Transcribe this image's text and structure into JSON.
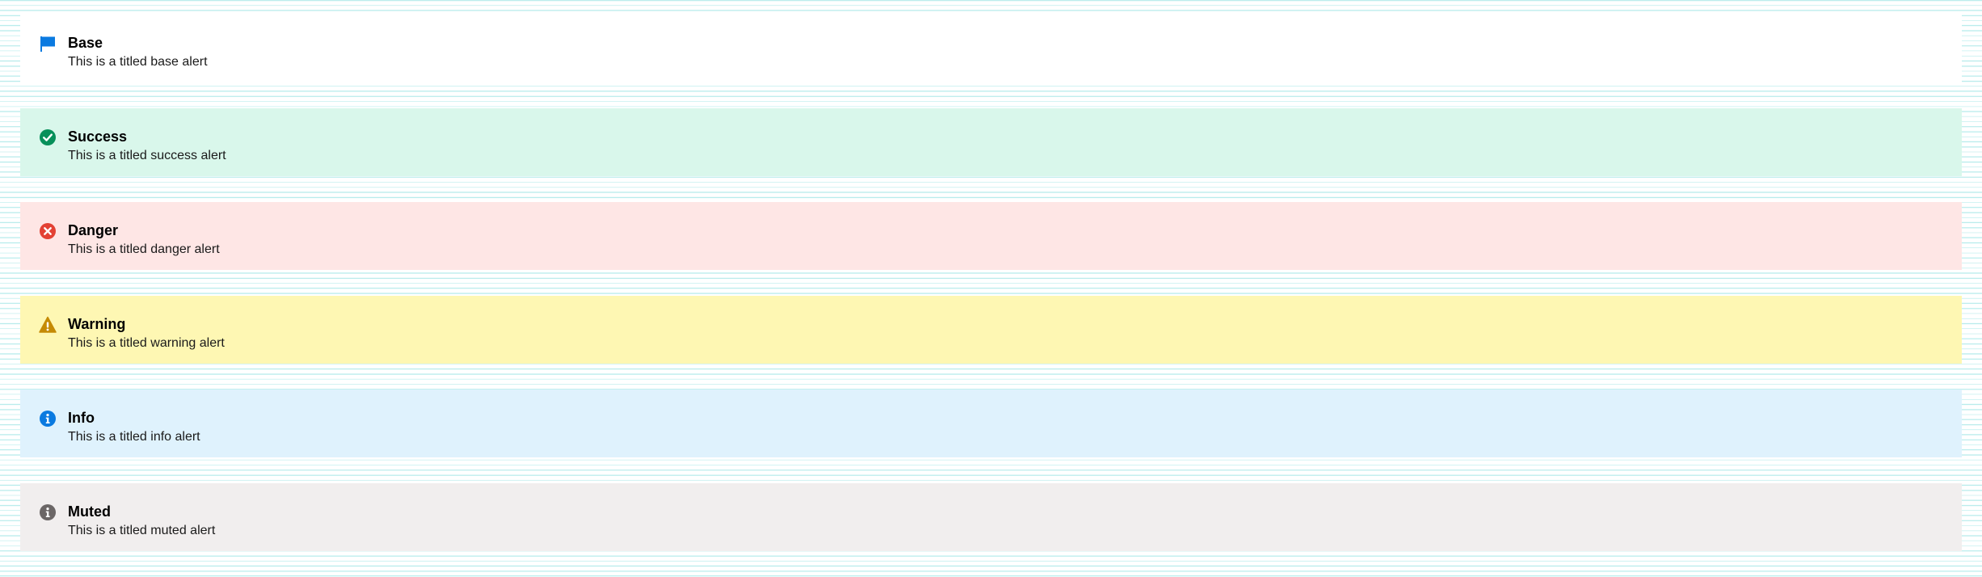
{
  "alerts": [
    {
      "variant": "base",
      "icon": "flag-icon",
      "color": "#0a7ae0",
      "title": "Base",
      "body": "This is a titled base alert",
      "background": "#ffffff"
    },
    {
      "variant": "success",
      "icon": "check-circle-icon",
      "color": "#07905a",
      "title": "Success",
      "body": "This is a titled success alert",
      "background": "#d9f7eb"
    },
    {
      "variant": "danger",
      "icon": "x-circle-icon",
      "color": "#e34134",
      "title": "Danger",
      "body": "This is a titled danger alert",
      "background": "#fee6e5"
    },
    {
      "variant": "warning",
      "icon": "warning-triangle-icon",
      "color": "#c58a05",
      "title": "Warning",
      "body": "This is a titled warning alert",
      "background": "#fef7b3"
    },
    {
      "variant": "info",
      "icon": "info-circle-icon",
      "color": "#0a7ae0",
      "title": "Info",
      "body": "This is a titled info alert",
      "background": "#dff2fd"
    },
    {
      "variant": "muted",
      "icon": "info-circle-icon",
      "color": "#6b6666",
      "title": "Muted",
      "body": "This is a titled muted alert",
      "background": "#f1eeee"
    }
  ]
}
